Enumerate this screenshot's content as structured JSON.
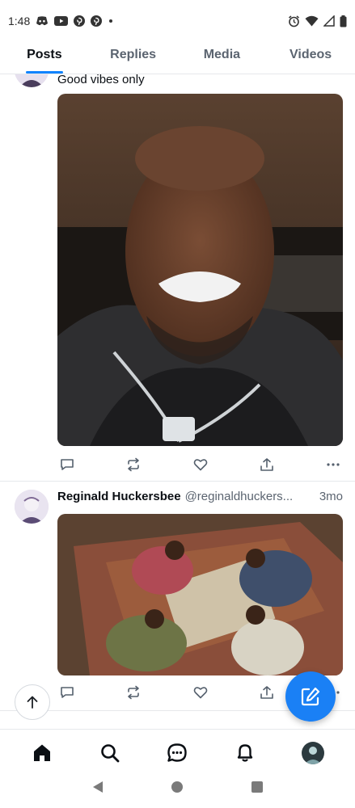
{
  "status_bar": {
    "time": "1:48",
    "notification_icons": [
      "discord-icon",
      "youtube-icon",
      "pinterest-icon",
      "pinterest-icon",
      "dot-icon"
    ],
    "system_icons": [
      "alarm-icon",
      "wifi-icon",
      "signal-icon",
      "battery-icon"
    ]
  },
  "tabs": [
    {
      "label": "Posts",
      "active": true
    },
    {
      "label": "Replies",
      "active": false
    },
    {
      "label": "Media",
      "active": false
    },
    {
      "label": "Videos",
      "active": false
    }
  ],
  "posts": [
    {
      "text": "Good vibes only",
      "image_description": "selfie-video-thumbnail",
      "actions": [
        "reply-icon",
        "repost-icon",
        "like-icon",
        "share-icon",
        "more-icon"
      ]
    },
    {
      "author_name": "Reginald Huckersbee",
      "author_handle": "@reginaldhuckers...",
      "time": "3mo",
      "image_description": "game-scene-card-table",
      "actions": [
        "reply-icon",
        "repost-icon",
        "like-icon",
        "share-icon",
        "more-icon"
      ]
    }
  ],
  "bottom_nav": [
    "home-icon",
    "search-icon",
    "chat-icon",
    "bell-icon",
    "profile-avatar"
  ],
  "colors": {
    "accent": "#1083fe",
    "fab": "#1a80f5",
    "text": "#0b0f14",
    "muted": "#5b6470",
    "icon": "#55606d"
  }
}
